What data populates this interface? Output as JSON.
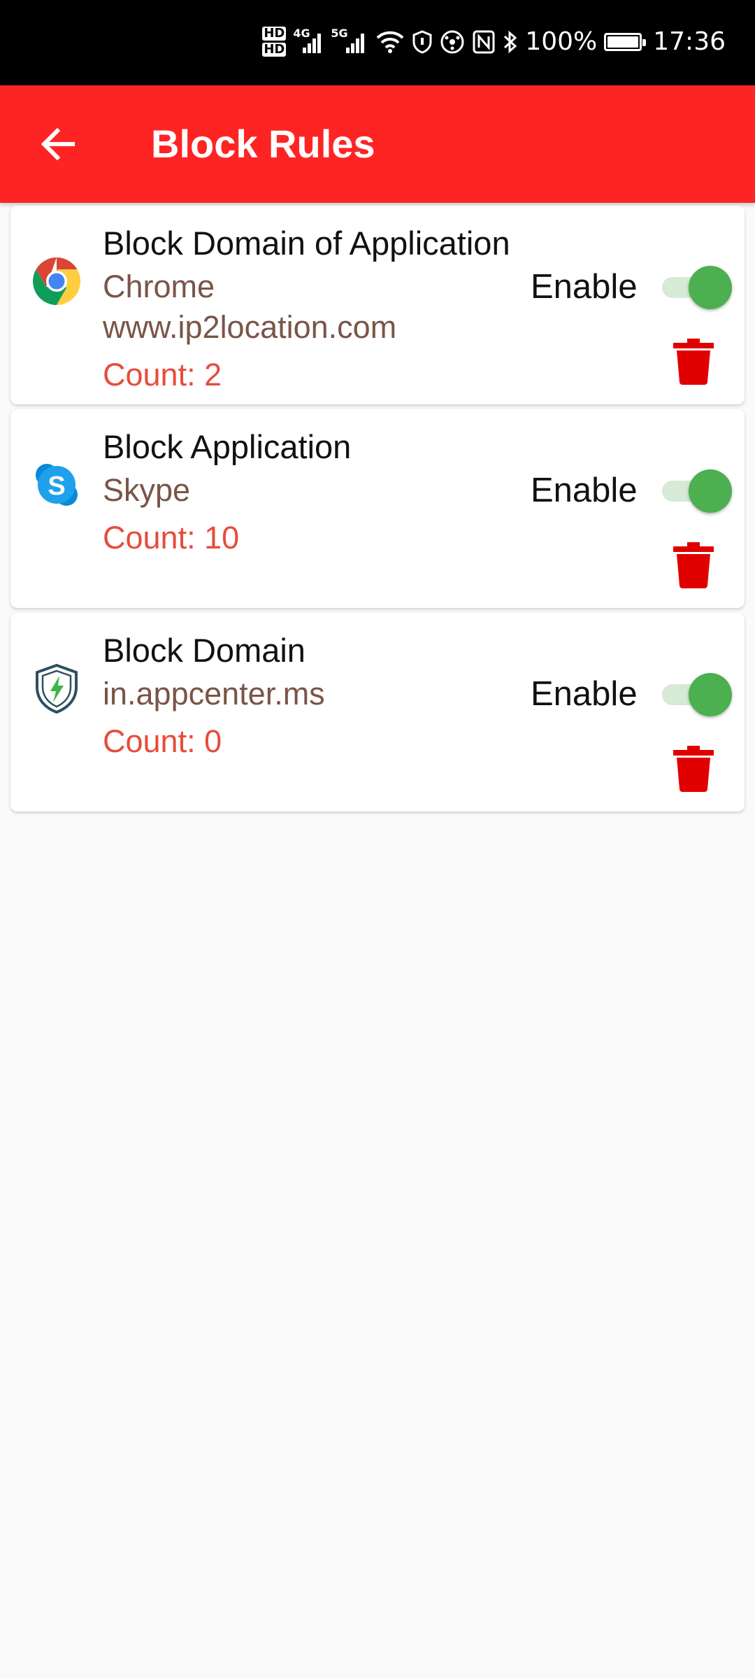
{
  "status_bar": {
    "hd_top": "HD",
    "hd_bottom": "HD",
    "net1": "4G",
    "net2": "5G",
    "battery_percent": "100%",
    "time": "17:36",
    "icons": [
      "hd-icon",
      "signal-4g-icon",
      "signal-5g-icon",
      "wifi-icon",
      "vpn-shield-icon",
      "hotspot-icon",
      "nfc-icon",
      "bluetooth-icon",
      "battery-charging-icon"
    ]
  },
  "app_bar": {
    "title": "Block Rules",
    "back_icon": "arrow-back-icon",
    "background": "#ff2424"
  },
  "rules": [
    {
      "type": "Block Domain of Application",
      "app": "Chrome",
      "domain": "www.ip2location.com",
      "count": "Count: 2",
      "enable_label": "Enable",
      "enabled": true,
      "icon": "chrome-icon"
    },
    {
      "type": "Block Application",
      "app": "Skype",
      "count": "Count: 10",
      "enable_label": "Enable",
      "enabled": true,
      "icon": "skype-icon"
    },
    {
      "type": "Block Domain",
      "domain": "in.appcenter.ms",
      "count": "Count: 0",
      "enable_label": "Enable",
      "enabled": true,
      "icon": "shield-bolt-icon"
    }
  ],
  "colors": {
    "toggle_on": "#4caf50",
    "delete": "#e00000",
    "count_text": "#e74c3c",
    "detail_text": "#795548"
  }
}
